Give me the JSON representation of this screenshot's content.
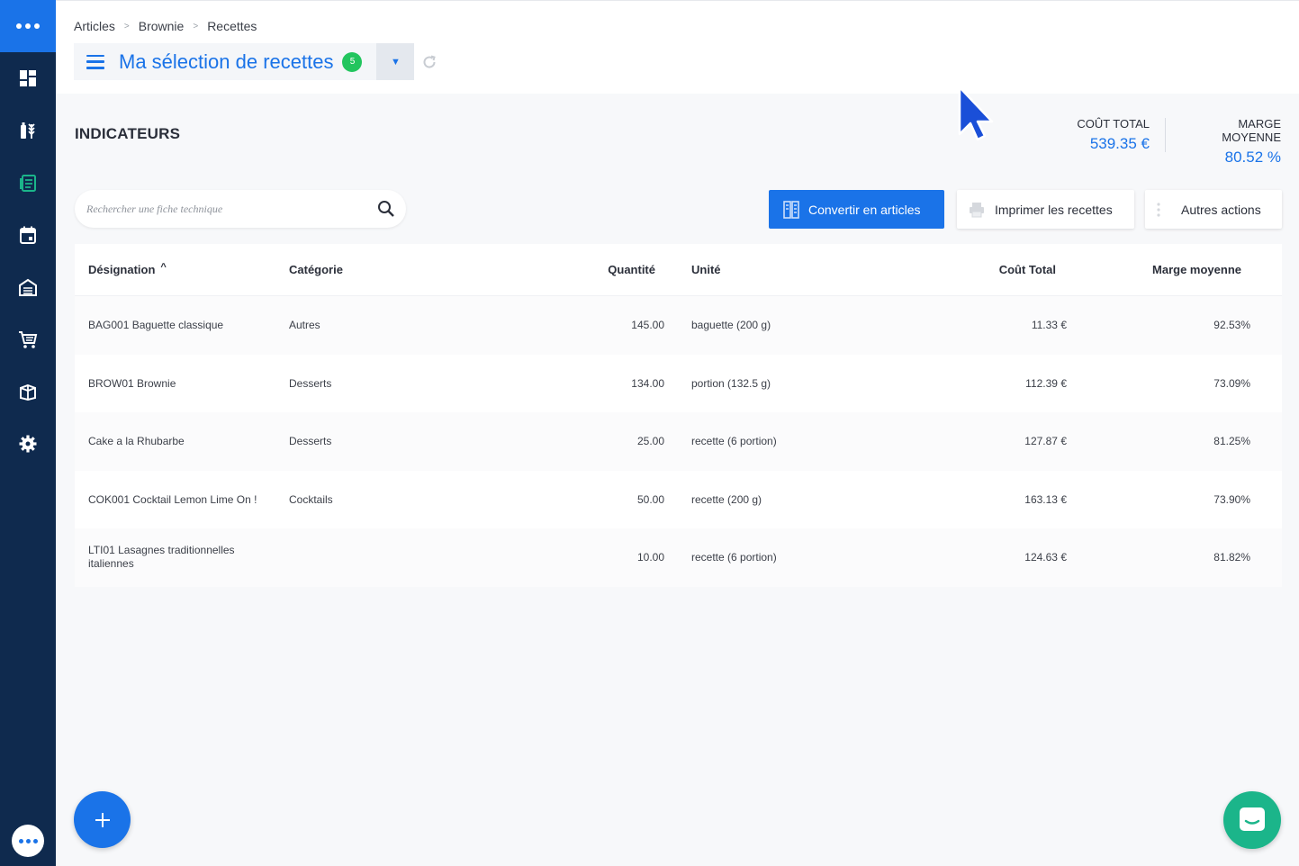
{
  "breadcrumb": [
    "Articles",
    "Brownie",
    "Recettes"
  ],
  "selection": {
    "title": "Ma sélection de recettes",
    "badge_count": "5"
  },
  "indicators": {
    "title": "INDICATEURS",
    "total_cost_label": "COÛT TOTAL",
    "total_cost_value": "539.35 €",
    "avg_margin_label": "MARGE MOYENNE",
    "avg_margin_value": "80.52 %"
  },
  "search": {
    "placeholder": "Rechercher une fiche technique"
  },
  "actions": {
    "convert_label": "Convertir en articles",
    "print_label": "Imprimer les recettes",
    "more_label": "Autres actions"
  },
  "table": {
    "columns": [
      "Désignation",
      "Catégorie",
      "Quantité",
      "Unité",
      "Coût Total",
      "Marge moyenne"
    ],
    "sort_indicator": "^",
    "rows": [
      {
        "designation": "BAG001 Baguette classique",
        "categorie": "Autres",
        "quantite": "145.00",
        "unite": "baguette (200 g)",
        "cout": "11.33 €",
        "marge": "92.53%"
      },
      {
        "designation": "BROW01 Brownie",
        "categorie": "Desserts",
        "quantite": "134.00",
        "unite": "portion (132.5 g)",
        "cout": "112.39 €",
        "marge": "73.09%"
      },
      {
        "designation": "Cake a la Rhubarbe",
        "categorie": "Desserts",
        "quantite": "25.00",
        "unite": "recette (6 portion)",
        "cout": "127.87 €",
        "marge": "81.25%"
      },
      {
        "designation": "COK001 Cocktail Lemon Lime On !",
        "categorie": "Cocktails",
        "quantite": "50.00",
        "unite": "recette (200 g)",
        "cout": "163.13 €",
        "marge": "73.90%"
      },
      {
        "designation": "LTI01 Lasagnes traditionnelles italiennes",
        "categorie": "",
        "quantite": "10.00",
        "unite": "recette (6 portion)",
        "cout": "124.63 €",
        "marge": "81.82%"
      }
    ]
  },
  "colors": {
    "primary": "#1a73e8",
    "sidebar": "#0f2a4e",
    "badge": "#22c55e",
    "chat": "#1bb58a"
  },
  "icons": {
    "sidebar": [
      "dashboard-icon",
      "ingredients-icon",
      "recipes-icon",
      "calendar-icon",
      "warehouse-icon",
      "cart-icon",
      "catalog-icon",
      "gear-icon"
    ]
  }
}
